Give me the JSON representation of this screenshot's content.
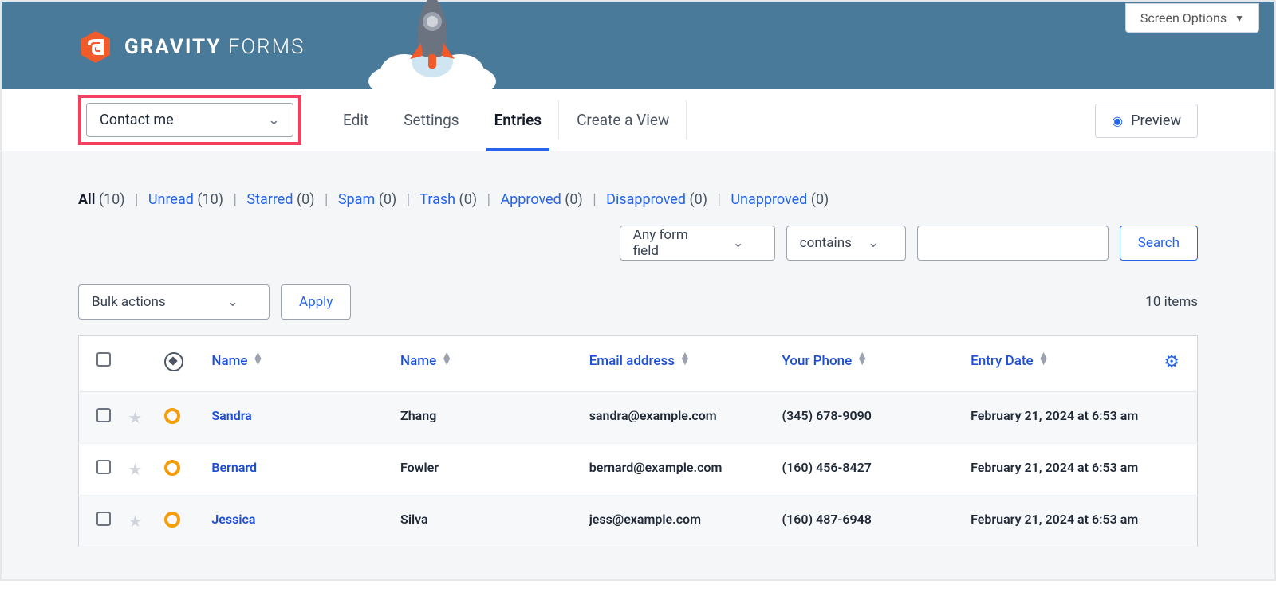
{
  "screen_options_label": "Screen Options",
  "logo_text_bold": "GRAVITY",
  "logo_text_light": "FORMS",
  "form_select_value": "Contact me",
  "tabs": {
    "edit": "Edit",
    "settings": "Settings",
    "entries": "Entries",
    "create_view": "Create a View"
  },
  "preview_label": "Preview",
  "filters": {
    "all": {
      "label": "All",
      "count": "(10)"
    },
    "unread": {
      "label": "Unread",
      "count": "(10)"
    },
    "starred": {
      "label": "Starred",
      "count": "(0)"
    },
    "spam": {
      "label": "Spam",
      "count": "(0)"
    },
    "trash": {
      "label": "Trash",
      "count": "(0)"
    },
    "approved": {
      "label": "Approved",
      "count": "(0)"
    },
    "disapproved": {
      "label": "Disapproved",
      "count": "(0)"
    },
    "unapproved": {
      "label": "Unapproved",
      "count": "(0)"
    }
  },
  "search": {
    "field_select": "Any form field",
    "operator_select": "contains",
    "button": "Search"
  },
  "bulk": {
    "select": "Bulk actions",
    "apply": "Apply"
  },
  "items_count": "10 items",
  "columns": {
    "name1": "Name",
    "name2": "Name",
    "email": "Email address",
    "phone": "Your Phone",
    "date": "Entry Date"
  },
  "rows": [
    {
      "first": "Sandra",
      "last": "Zhang",
      "email": "sandra@example.com",
      "phone": "(345) 678-9090",
      "date": "February 21, 2024 at 6:53 am"
    },
    {
      "first": "Bernard",
      "last": "Fowler",
      "email": "bernard@example.com",
      "phone": "(160) 456-8427",
      "date": "February 21, 2024 at 6:53 am"
    },
    {
      "first": "Jessica",
      "last": "Silva",
      "email": "jess@example.com",
      "phone": "(160) 487-6948",
      "date": "February 21, 2024 at 6:53 am"
    }
  ]
}
